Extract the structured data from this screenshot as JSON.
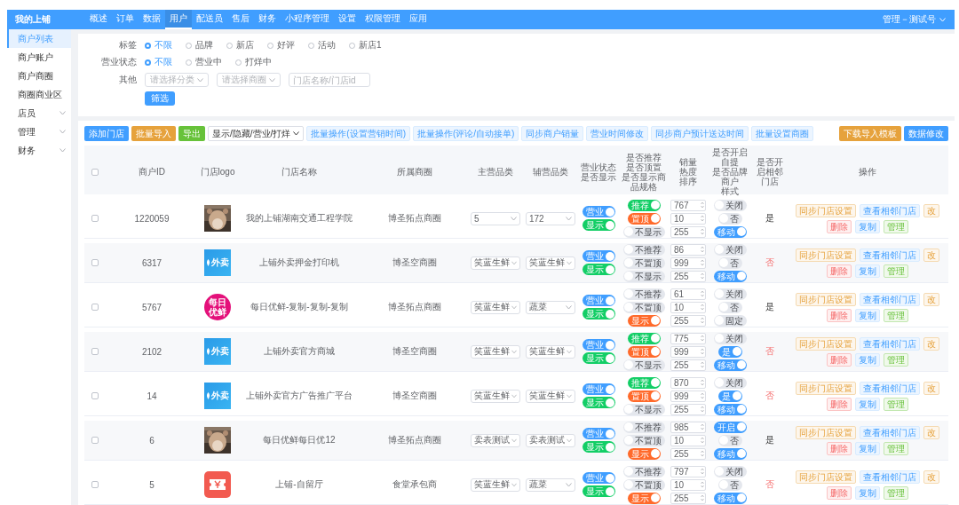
{
  "app": {
    "title": "我的上铺"
  },
  "nav": [
    {
      "label": "概述",
      "selected": false
    },
    {
      "label": "订单",
      "selected": false
    },
    {
      "label": "数据",
      "selected": false
    },
    {
      "label": "用户",
      "selected": true
    },
    {
      "label": "配送员",
      "selected": false
    },
    {
      "label": "售后",
      "selected": false
    },
    {
      "label": "财务",
      "selected": false
    },
    {
      "label": "小程序管理",
      "selected": false
    },
    {
      "label": "设置",
      "selected": false
    },
    {
      "label": "权限管理",
      "selected": false
    },
    {
      "label": "应用",
      "selected": false
    }
  ],
  "user": {
    "name": "管理－测试号"
  },
  "sidebar": {
    "items": [
      {
        "label": "商户列表",
        "selected": true,
        "kind": "link"
      },
      {
        "label": "商户账户",
        "selected": false,
        "kind": "link"
      },
      {
        "label": "商户商圈",
        "selected": false,
        "kind": "link"
      },
      {
        "label": "商圈商业区",
        "selected": false,
        "kind": "link"
      },
      {
        "label": "店员",
        "selected": false,
        "kind": "group"
      },
      {
        "label": "管理",
        "selected": false,
        "kind": "group"
      },
      {
        "label": "财务",
        "selected": false,
        "kind": "group"
      }
    ]
  },
  "filters": {
    "groups": [
      {
        "label": "标签",
        "options": [
          {
            "label": "不限",
            "selected": true
          },
          {
            "label": "品牌",
            "selected": false
          },
          {
            "label": "新店",
            "selected": false
          },
          {
            "label": "好评",
            "selected": false
          },
          {
            "label": "活动",
            "selected": false
          },
          {
            "label": "新店1",
            "selected": false
          }
        ]
      },
      {
        "label": "营业状态",
        "options": [
          {
            "label": "不限",
            "selected": true
          },
          {
            "label": "营业中",
            "selected": false
          },
          {
            "label": "打烊中",
            "selected": false
          }
        ]
      }
    ],
    "other": {
      "label": "其他",
      "selects": [
        {
          "placeholder": "请选择分类"
        },
        {
          "placeholder": "请选择商圈"
        }
      ],
      "search": {
        "placeholder": "门店名称/门店id"
      }
    },
    "submit": "筛选"
  },
  "toolbar": {
    "left": [
      {
        "label": "添加门店",
        "kind": "primary"
      },
      {
        "label": "批量导入",
        "kind": "warning"
      },
      {
        "label": "导出",
        "kind": "success"
      },
      {
        "label": "显示/隐藏/营业/打烊",
        "kind": "dropdown"
      },
      {
        "label": "批量操作(设置营销时间)",
        "kind": "plain"
      },
      {
        "label": "批量操作(评论/自动接单)",
        "kind": "plain"
      },
      {
        "label": "同步商户销量",
        "kind": "plain"
      },
      {
        "label": "营业时间修改",
        "kind": "plain"
      },
      {
        "label": "同步商户预计送达时间",
        "kind": "plain"
      },
      {
        "label": "批量设置商圈",
        "kind": "plain"
      }
    ],
    "right": [
      {
        "label": "下载导入模板",
        "kind": "warning"
      },
      {
        "label": "数据修改",
        "kind": "primary"
      }
    ]
  },
  "table": {
    "header_checkbox": {
      "checked": false
    },
    "columns": [
      {
        "lines": [
          "商户ID"
        ]
      },
      {
        "lines": [
          "门店logo"
        ]
      },
      {
        "lines": [
          "门店名称"
        ]
      },
      {
        "lines": [
          "所属商圈"
        ]
      },
      {
        "lines": [
          "主营品类"
        ]
      },
      {
        "lines": [
          "辅营品类"
        ]
      },
      {
        "lines": [
          "营业状态",
          "是否显示"
        ]
      },
      {
        "lines": [
          "是否推荐",
          "是否顶置",
          "是否显示商品规格"
        ]
      },
      {
        "lines": [
          "销量",
          "热度",
          "排序"
        ]
      },
      {
        "lines": [
          "是否开启自提",
          "是否品牌商户",
          "样式"
        ]
      },
      {
        "lines": [
          "是否开启相邻门店"
        ]
      },
      {
        "lines": [
          "操作"
        ]
      }
    ],
    "rows": [
      {
        "checked": false,
        "id": "1220059",
        "logo": {
          "kind": "picture"
        },
        "name": "我的上铺湖南交通工程学院",
        "area": "博圣拓点商圈",
        "main_category": "5",
        "sub_category": "172",
        "status": [
          {
            "label": "营业",
            "on": true
          },
          {
            "label": "显示",
            "on": true
          }
        ],
        "flags": [
          {
            "label": "推荐",
            "on": true
          },
          {
            "label": "置顶",
            "on": true
          },
          {
            "label": "不显示",
            "on": false
          }
        ],
        "numbers": [
          "767",
          "10",
          "255"
        ],
        "options": [
          {
            "label": "关闭",
            "on": false
          },
          {
            "label": "否",
            "on": false
          },
          {
            "label": "移动",
            "on": true
          }
        ],
        "neighbor": {
          "text": "是",
          "kind": "yes"
        },
        "actions": [
          {
            "label": "同步门店设置",
            "kind": "warning"
          },
          {
            "label": "查看相邻门店",
            "kind": "primary"
          },
          {
            "label": "改",
            "kind": "warning"
          },
          {
            "label": "删除",
            "kind": "danger"
          },
          {
            "label": "复制",
            "kind": "primary"
          },
          {
            "label": "管理",
            "kind": "success"
          }
        ]
      },
      {
        "checked": false,
        "id": "6317",
        "logo": {
          "kind": "takeout",
          "text": "外卖"
        },
        "name": "上铺外卖押金打印机",
        "area": "博圣空商圈",
        "main_category": "笑蓝生鲜",
        "sub_category": "笑蓝生鲜",
        "status": [
          {
            "label": "营业",
            "on": true
          },
          {
            "label": "显示",
            "on": true
          }
        ],
        "flags": [
          {
            "label": "不推荐",
            "on": false
          },
          {
            "label": "不置顶",
            "on": false
          },
          {
            "label": "不显示",
            "on": false
          }
        ],
        "numbers": [
          "86",
          "999",
          "255"
        ],
        "options": [
          {
            "label": "关闭",
            "on": false
          },
          {
            "label": "否",
            "on": false
          },
          {
            "label": "移动",
            "on": true
          }
        ],
        "neighbor": {
          "text": "否",
          "kind": "no"
        },
        "actions": [
          {
            "label": "同步门店设置",
            "kind": "warning"
          },
          {
            "label": "查看相邻门店",
            "kind": "primary"
          },
          {
            "label": "改",
            "kind": "warning"
          },
          {
            "label": "删除",
            "kind": "danger"
          },
          {
            "label": "复制",
            "kind": "primary"
          },
          {
            "label": "管理",
            "kind": "success"
          }
        ]
      },
      {
        "checked": false,
        "id": "5767",
        "logo": {
          "kind": "circle",
          "text": "每日优鲜"
        },
        "name": "每日优鲜-复制-复制-复制",
        "area": "博圣拓点商圈",
        "main_category": "笑蓝生鲜",
        "sub_category": "蔬菜",
        "status": [
          {
            "label": "营业",
            "on": true
          },
          {
            "label": "显示",
            "on": true
          }
        ],
        "flags": [
          {
            "label": "不推荐",
            "on": false
          },
          {
            "label": "不置顶",
            "on": false
          },
          {
            "label": "显示",
            "on": true
          }
        ],
        "numbers": [
          "61",
          "10",
          "255"
        ],
        "options": [
          {
            "label": "关闭",
            "on": false
          },
          {
            "label": "否",
            "on": false
          },
          {
            "label": "固定",
            "on": false
          }
        ],
        "neighbor": {
          "text": "是",
          "kind": "yes"
        },
        "actions": [
          {
            "label": "同步门店设置",
            "kind": "warning"
          },
          {
            "label": "查看相邻门店",
            "kind": "primary"
          },
          {
            "label": "改",
            "kind": "warning"
          },
          {
            "label": "删除",
            "kind": "danger"
          },
          {
            "label": "复制",
            "kind": "primary"
          },
          {
            "label": "管理",
            "kind": "success"
          }
        ]
      },
      {
        "checked": false,
        "id": "2102",
        "logo": {
          "kind": "takeout",
          "text": "外卖"
        },
        "name": "上铺外卖官方商城",
        "area": "博圣空商圈",
        "main_category": "笑蓝生鲜",
        "sub_category": "笑蓝生鲜",
        "status": [
          {
            "label": "营业",
            "on": true
          },
          {
            "label": "显示",
            "on": true
          }
        ],
        "flags": [
          {
            "label": "推荐",
            "on": true
          },
          {
            "label": "置顶",
            "on": true
          },
          {
            "label": "不显示",
            "on": false
          }
        ],
        "numbers": [
          "775",
          "999",
          "255"
        ],
        "options": [
          {
            "label": "关闭",
            "on": false
          },
          {
            "label": "是",
            "on": true
          },
          {
            "label": "移动",
            "on": true
          }
        ],
        "neighbor": {
          "text": "否",
          "kind": "no"
        },
        "actions": [
          {
            "label": "同步门店设置",
            "kind": "warning"
          },
          {
            "label": "查看相邻门店",
            "kind": "primary"
          },
          {
            "label": "改",
            "kind": "warning"
          },
          {
            "label": "删除",
            "kind": "danger"
          },
          {
            "label": "复制",
            "kind": "primary"
          },
          {
            "label": "管理",
            "kind": "success"
          }
        ]
      },
      {
        "checked": false,
        "id": "14",
        "logo": {
          "kind": "takeout",
          "text": "外卖"
        },
        "name": "上铺外卖官方广告推广平台",
        "area": "博圣空商圈",
        "main_category": "笑蓝生鲜",
        "sub_category": "笑蓝生鲜",
        "status": [
          {
            "label": "营业",
            "on": true
          },
          {
            "label": "显示",
            "on": true
          }
        ],
        "flags": [
          {
            "label": "推荐",
            "on": true
          },
          {
            "label": "置顶",
            "on": true
          },
          {
            "label": "不显示",
            "on": false
          }
        ],
        "numbers": [
          "870",
          "999",
          "255"
        ],
        "options": [
          {
            "label": "关闭",
            "on": false
          },
          {
            "label": "是",
            "on": true
          },
          {
            "label": "移动",
            "on": true
          }
        ],
        "neighbor": {
          "text": "否",
          "kind": "no"
        },
        "actions": [
          {
            "label": "同步门店设置",
            "kind": "warning"
          },
          {
            "label": "查看相邻门店",
            "kind": "primary"
          },
          {
            "label": "改",
            "kind": "warning"
          },
          {
            "label": "删除",
            "kind": "danger"
          },
          {
            "label": "复制",
            "kind": "primary"
          },
          {
            "label": "管理",
            "kind": "success"
          }
        ]
      },
      {
        "checked": false,
        "id": "6",
        "logo": {
          "kind": "picture"
        },
        "name": "每日优鲜每日优12",
        "area": "博圣拓点商圈",
        "main_category": "卖表测试",
        "sub_category": "卖表测试",
        "status": [
          {
            "label": "营业",
            "on": true
          },
          {
            "label": "显示",
            "on": true
          }
        ],
        "flags": [
          {
            "label": "不推荐",
            "on": false
          },
          {
            "label": "不置顶",
            "on": false
          },
          {
            "label": "显示",
            "on": true
          }
        ],
        "numbers": [
          "985",
          "10",
          "255"
        ],
        "options": [
          {
            "label": "开启",
            "on": true
          },
          {
            "label": "否",
            "on": false
          },
          {
            "label": "移动",
            "on": true
          }
        ],
        "neighbor": {
          "text": "是",
          "kind": "yes"
        },
        "actions": [
          {
            "label": "同步门店设置",
            "kind": "warning"
          },
          {
            "label": "查看相邻门店",
            "kind": "primary"
          },
          {
            "label": "改",
            "kind": "warning"
          },
          {
            "label": "删除",
            "kind": "danger"
          },
          {
            "label": "复制",
            "kind": "primary"
          },
          {
            "label": "管理",
            "kind": "success"
          }
        ]
      },
      {
        "checked": false,
        "id": "5",
        "logo": {
          "kind": "ticket"
        },
        "name": "上铺-自留厅",
        "area": "食堂承包商",
        "main_category": "笑蓝生鲜",
        "sub_category": "蔬菜",
        "status": [
          {
            "label": "营业",
            "on": true
          },
          {
            "label": "显示",
            "on": true
          }
        ],
        "flags": [
          {
            "label": "不推荐",
            "on": false
          },
          {
            "label": "不置顶",
            "on": false
          },
          {
            "label": "显示",
            "on": true
          }
        ],
        "numbers": [
          "797",
          "10",
          "255"
        ],
        "options": [
          {
            "label": "关闭",
            "on": false
          },
          {
            "label": "否",
            "on": false
          },
          {
            "label": "移动",
            "on": true
          }
        ],
        "neighbor": {
          "text": "否",
          "kind": "no"
        },
        "actions": [
          {
            "label": "同步门店设置",
            "kind": "warning"
          },
          {
            "label": "查看相邻门店",
            "kind": "primary"
          },
          {
            "label": "改",
            "kind": "warning"
          },
          {
            "label": "删除",
            "kind": "danger"
          },
          {
            "label": "复制",
            "kind": "primary"
          },
          {
            "label": "管理",
            "kind": "success"
          }
        ]
      }
    ]
  }
}
